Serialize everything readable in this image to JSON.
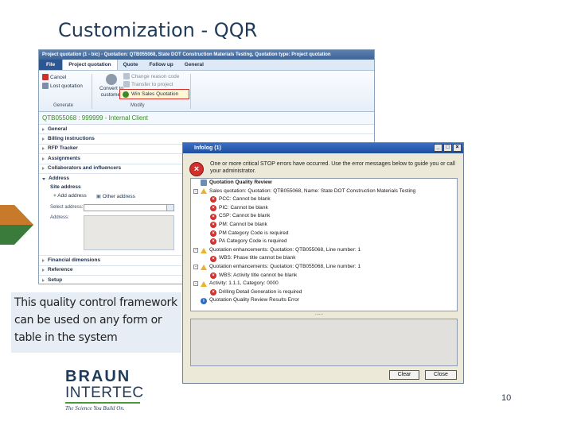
{
  "slide": {
    "title": "Customization - QQR",
    "caption": "This quality control framework can be used on any form or table in the system",
    "page_number": "10"
  },
  "logo": {
    "line1": "BRAUN",
    "line2": "INTERTEC",
    "tagline": "The Science You Build On."
  },
  "app": {
    "titlebar": "Project quotation (1 - bic) - Quotation: QTB055068, State DOT Construction Materials Testing, Quotation type: Project quotation",
    "tabs": [
      "File",
      "Project quotation",
      "Quote",
      "Follow up",
      "General"
    ],
    "ribbon": {
      "cancel": "Cancel",
      "lost_quotation": "Lost quotation",
      "convert_line1": "Convert to",
      "convert_line2": "customer",
      "change_reason": "Change reason code",
      "transfer_project": "Transfer to project",
      "win_sales": "Win Sales Quotation",
      "group_generate": "Generate",
      "group_modify": "Modify"
    },
    "client_bar": "QTB055068 : 999999 - Internal Client",
    "fasttabs_top": [
      "General",
      "Billing instructions",
      "RFP Tracker",
      "Assignments",
      "Collaborators and influencers",
      "Address"
    ],
    "address": {
      "section": "Site address",
      "add_address": "Add address",
      "other_address": "Other address",
      "select_label": "Select address:",
      "address_label": "Address:"
    },
    "fasttabs_bottom": [
      "Financial dimensions",
      "Reference",
      "Setup"
    ],
    "colors": {
      "accent": "#2b5797",
      "highlight": "#d0302e",
      "client_green": "#3a8a2a"
    }
  },
  "infolog": {
    "title": "Infolog (1)",
    "message": "One or more critical STOP errors have occurred. Use the error messages below to guide you or call your administrator.",
    "rows": [
      {
        "text": "Quotation Quality Review",
        "level": 0,
        "icon": "tool-icon",
        "expander": ""
      },
      {
        "text": "Sales quotation: Quotation: QTB055068, Name: State DOT Construction Materials Testing",
        "level": 0,
        "icon": "warning-icon",
        "expander": "-"
      },
      {
        "text": "PCC: Cannot be blank",
        "level": 1,
        "icon": "error-icon",
        "expander": ""
      },
      {
        "text": "PIC: Cannot be blank",
        "level": 1,
        "icon": "error-icon",
        "expander": ""
      },
      {
        "text": "CSP: Cannot be blank",
        "level": 1,
        "icon": "error-icon",
        "expander": ""
      },
      {
        "text": "PM: Cannot be blank",
        "level": 1,
        "icon": "error-icon",
        "expander": ""
      },
      {
        "text": "PM Category Code is required",
        "level": 1,
        "icon": "error-icon",
        "expander": ""
      },
      {
        "text": "PA Category Code is required",
        "level": 1,
        "icon": "error-icon",
        "expander": ""
      },
      {
        "text": "Quotation enhancements: Quotation: QTB055068, Line number: 1",
        "level": 0,
        "icon": "warning-icon",
        "expander": "-"
      },
      {
        "text": "WBS: Phase title cannot be blank",
        "level": 1,
        "icon": "error-icon",
        "expander": ""
      },
      {
        "text": "Quotation enhancements: Quotation: QTB055068, Line number: 1",
        "level": 0,
        "icon": "warning-icon",
        "expander": "-"
      },
      {
        "text": "WBS: Activity title cannot be blank",
        "level": 1,
        "icon": "error-icon",
        "expander": ""
      },
      {
        "text": "Activity: 1.1.1, Category: 0000",
        "level": 0,
        "icon": "warning-icon",
        "expander": "-"
      },
      {
        "text": "Drilling Detail Generation is required",
        "level": 1,
        "icon": "error-icon",
        "expander": ""
      },
      {
        "text": "Quotation Quality Review Results Error",
        "level": 0,
        "icon": "info-icon",
        "expander": ""
      }
    ],
    "separator": "......",
    "buttons": {
      "clear": "Clear",
      "close": "Close"
    }
  }
}
